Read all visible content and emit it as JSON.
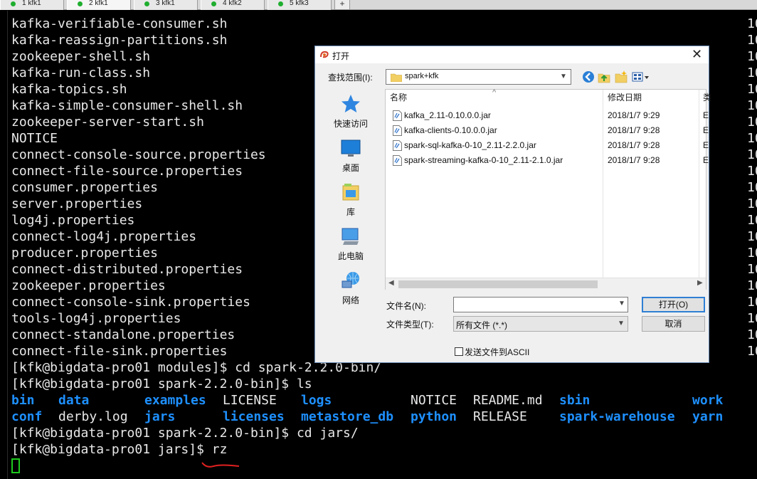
{
  "tabs": [
    {
      "label": "1 kfk1"
    },
    {
      "label": "2 kfk1"
    },
    {
      "label": "3 kfk1"
    },
    {
      "label": "4 kfk2"
    },
    {
      "label": "5 kfk3"
    }
  ],
  "tab_add": "+",
  "terminal": {
    "listing": [
      "kafka-verifiable-consumer.sh",
      "kafka-reassign-partitions.sh",
      "zookeeper-shell.sh",
      "kafka-run-class.sh",
      "kafka-topics.sh",
      "kafka-simple-consumer-shell.sh",
      "zookeeper-server-start.sh",
      "NOTICE",
      "connect-console-source.properties",
      "connect-file-source.properties",
      "consumer.properties",
      "server.properties",
      "log4j.properties",
      "connect-log4j.properties",
      "producer.properties",
      "connect-distributed.properties",
      "zookeeper.properties",
      "connect-console-sink.properties",
      "tools-log4j.properties",
      "connect-standalone.properties",
      "connect-file-sink.properties"
    ],
    "right_column": [
      "10",
      "10",
      "10",
      "10",
      "10",
      "10",
      "10",
      "10",
      "10",
      "10",
      "10",
      "10",
      "10",
      "10",
      "10",
      "10",
      "10",
      "10",
      "10",
      "10",
      "10"
    ],
    "cmd1": "[kfk@bigdata-pro01 modules]$ cd spark-2.2.0-bin/",
    "cmd2": "[kfk@bigdata-pro01 spark-2.2.0-bin]$ ls",
    "ls_row1": {
      "c1": "bin",
      "c2": "data",
      "c3": "examples",
      "c4": "LICENSE",
      "c5": "logs",
      "c6": "NOTICE",
      "c7": "README.md",
      "c8": "sbin",
      "c9": "work"
    },
    "ls_row2": {
      "c1": "conf",
      "c2": "derby.log",
      "c3": "jars",
      "c4": "licenses",
      "c5": "metastore_db",
      "c6": "python",
      "c7": "RELEASE",
      "c8": "spark-warehouse",
      "c9": "yarn"
    },
    "cmd3": "[kfk@bigdata-pro01 spark-2.2.0-bin]$ cd jars/",
    "cmd4": "[kfk@bigdata-pro01 jars]$ rz"
  },
  "dialog": {
    "title": "打开",
    "close": "✕",
    "lookin_label": "查找范围(I):",
    "lookin_value": "spark+kfk",
    "places": [
      {
        "label": "快速访问"
      },
      {
        "label": "桌面"
      },
      {
        "label": "库"
      },
      {
        "label": "此电脑"
      },
      {
        "label": "网络"
      }
    ],
    "columns": {
      "name": "名称",
      "date": "修改日期",
      "extra": "类"
    },
    "sort_indicator": "^",
    "files": [
      {
        "name": "kafka_2.11-0.10.0.0.jar",
        "date": "2018/1/7 9:29",
        "extra": "E"
      },
      {
        "name": "kafka-clients-0.10.0.0.jar",
        "date": "2018/1/7 9:28",
        "extra": "E"
      },
      {
        "name": "spark-sql-kafka-0-10_2.11-2.2.0.jar",
        "date": "2018/1/7 9:28",
        "extra": "E"
      },
      {
        "name": "spark-streaming-kafka-0-10_2.11-2.1.0.jar",
        "date": "2018/1/7 9:28",
        "extra": "E"
      }
    ],
    "filename_label": "文件名(N):",
    "filename_value": "",
    "filetype_label": "文件类型(T):",
    "filetype_value": "所有文件 (*.*)",
    "open_label": "打开(O)",
    "cancel_label": "取消",
    "ascii_label": "发送文件到ASCII"
  },
  "colors": {
    "terminal_bg": "#000000",
    "terminal_text": "#e8e8e8",
    "dir_blue": "#1e90ff",
    "cursor_green": "#1ec81e",
    "tab_dot_green": "#1fae2f",
    "annotation_red": "#e02020",
    "dialog_accent": "#2f7fd4"
  }
}
